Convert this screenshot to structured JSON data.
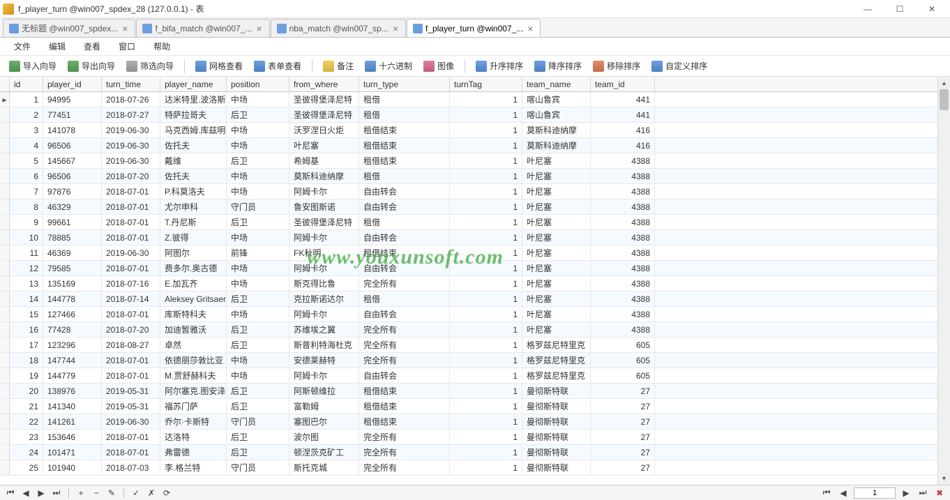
{
  "window": {
    "title": "f_player_turn @win007_spdex_28 (127.0.0.1) - 表"
  },
  "tabs": [
    {
      "label": "无标题 @win007_spdex...",
      "active": false
    },
    {
      "label": "f_bifa_match @win007_...",
      "active": false
    },
    {
      "label": "nba_match @win007_sp...",
      "active": false
    },
    {
      "label": "f_player_turn @win007_...",
      "active": true
    }
  ],
  "menu": [
    "文件",
    "编辑",
    "查看",
    "窗口",
    "帮助"
  ],
  "toolbar": {
    "import": "导入向导",
    "export": "导出向导",
    "filter": "筛选向导",
    "grid": "网格查看",
    "form": "表单查看",
    "note": "备注",
    "hex": "十六进制",
    "image": "图像",
    "asc": "升序排序",
    "desc": "降序排序",
    "remove": "移除排序",
    "custom": "自定义排序"
  },
  "columns": [
    "id",
    "player_id",
    "turn_time",
    "player_name",
    "position",
    "from_where",
    "turn_type",
    "turnTag",
    "team_name",
    "team_id"
  ],
  "rows": [
    {
      "id": 1,
      "player_id": "94995",
      "turn_time": "2018-07-26",
      "player_name": "达米特里.波洛斯",
      "position": "中场",
      "from_where": "圣彼得堡泽尼特",
      "turn_type": "租借",
      "turnTag": 1,
      "team_name": "喀山鲁宾",
      "team_id": 441
    },
    {
      "id": 2,
      "player_id": "77451",
      "turn_time": "2018-07-27",
      "player_name": "特萨拉哥夫",
      "position": "后卫",
      "from_where": "圣彼得堡泽尼特",
      "turn_type": "租借",
      "turnTag": 1,
      "team_name": "喀山鲁宾",
      "team_id": 441
    },
    {
      "id": 3,
      "player_id": "141078",
      "turn_time": "2019-06-30",
      "player_name": "马克西姆.库兹明",
      "position": "中场",
      "from_where": "沃罗涅日火炬",
      "turn_type": "租借结束",
      "turnTag": 1,
      "team_name": "莫斯科迪纳摩",
      "team_id": 416
    },
    {
      "id": 4,
      "player_id": "96506",
      "turn_time": "2019-06-30",
      "player_name": "佐托夫",
      "position": "中场",
      "from_where": "叶尼塞",
      "turn_type": "租借结束",
      "turnTag": 1,
      "team_name": "莫斯科迪纳摩",
      "team_id": 416
    },
    {
      "id": 5,
      "player_id": "145667",
      "turn_time": "2019-06-30",
      "player_name": "戴维",
      "position": "后卫",
      "from_where": "希姆基",
      "turn_type": "租借结束",
      "turnTag": 1,
      "team_name": "叶尼塞",
      "team_id": 4388
    },
    {
      "id": 6,
      "player_id": "96506",
      "turn_time": "2018-07-20",
      "player_name": "佐托夫",
      "position": "中场",
      "from_where": "莫斯科迪纳摩",
      "turn_type": "租借",
      "turnTag": 1,
      "team_name": "叶尼塞",
      "team_id": 4388
    },
    {
      "id": 7,
      "player_id": "97876",
      "turn_time": "2018-07-01",
      "player_name": "P.科莫洛夫",
      "position": "中场",
      "from_where": "阿姆卡尔",
      "turn_type": "自由转会",
      "turnTag": 1,
      "team_name": "叶尼塞",
      "team_id": 4388
    },
    {
      "id": 8,
      "player_id": "46329",
      "turn_time": "2018-07-01",
      "player_name": "尤尔申科",
      "position": "守门员",
      "from_where": "鲁安图斯诺",
      "turn_type": "自由转会",
      "turnTag": 1,
      "team_name": "叶尼塞",
      "team_id": 4388
    },
    {
      "id": 9,
      "player_id": "99661",
      "turn_time": "2018-07-01",
      "player_name": "T.丹尼斯",
      "position": "后卫",
      "from_where": "圣彼得堡泽尼特",
      "turn_type": "租借",
      "turnTag": 1,
      "team_name": "叶尼塞",
      "team_id": 4388
    },
    {
      "id": 10,
      "player_id": "78885",
      "turn_time": "2018-07-01",
      "player_name": "Z.彼得",
      "position": "中场",
      "from_where": "阿姆卡尔",
      "turn_type": "自由转会",
      "turnTag": 1,
      "team_name": "叶尼塞",
      "team_id": 4388
    },
    {
      "id": 11,
      "player_id": "46369",
      "turn_time": "2019-06-30",
      "player_name": "阿图尔",
      "position": "前锋",
      "from_where": "FK秋明",
      "turn_type": "租借结束",
      "turnTag": 1,
      "team_name": "叶尼塞",
      "team_id": 4388
    },
    {
      "id": 12,
      "player_id": "79585",
      "turn_time": "2018-07-01",
      "player_name": "费多尔.奥古德",
      "position": "中场",
      "from_where": "阿姆卡尔",
      "turn_type": "自由转会",
      "turnTag": 1,
      "team_name": "叶尼塞",
      "team_id": 4388
    },
    {
      "id": 13,
      "player_id": "135169",
      "turn_time": "2018-07-16",
      "player_name": "E.加瓦齐",
      "position": "中场",
      "from_where": "斯克得比鲁",
      "turn_type": "完全所有",
      "turnTag": 1,
      "team_name": "叶尼塞",
      "team_id": 4388
    },
    {
      "id": 14,
      "player_id": "144778",
      "turn_time": "2018-07-14",
      "player_name": "Aleksey Gritsaenl",
      "position": "后卫",
      "from_where": "克拉斯诺达尔",
      "turn_type": "租借",
      "turnTag": 1,
      "team_name": "叶尼塞",
      "team_id": 4388
    },
    {
      "id": 15,
      "player_id": "127466",
      "turn_time": "2018-07-01",
      "player_name": "库斯特科夫",
      "position": "中场",
      "from_where": "阿姆卡尔",
      "turn_type": "自由转会",
      "turnTag": 1,
      "team_name": "叶尼塞",
      "team_id": 4388
    },
    {
      "id": 16,
      "player_id": "77428",
      "turn_time": "2018-07-20",
      "player_name": "加迪暂雅沃",
      "position": "后卫",
      "from_where": "苏维埃之翼",
      "turn_type": "完全所有",
      "turnTag": 1,
      "team_name": "叶尼塞",
      "team_id": 4388
    },
    {
      "id": 17,
      "player_id": "123296",
      "turn_time": "2018-08-27",
      "player_name": "卓然",
      "position": "后卫",
      "from_where": "斯普利特海杜克",
      "turn_type": "完全所有",
      "turnTag": 1,
      "team_name": "格罗兹尼特里克",
      "team_id": 605
    },
    {
      "id": 18,
      "player_id": "147744",
      "turn_time": "2018-07-01",
      "player_name": "依德丽莎敦比亚",
      "position": "中场",
      "from_where": "安德莱赫特",
      "turn_type": "完全所有",
      "turnTag": 1,
      "team_name": "格罗兹尼特里克",
      "team_id": 605
    },
    {
      "id": 19,
      "player_id": "144779",
      "turn_time": "2018-07-01",
      "player_name": "M.贾舒赫科夫",
      "position": "中场",
      "from_where": "阿姆卡尔",
      "turn_type": "自由转会",
      "turnTag": 1,
      "team_name": "格罗兹尼特里克",
      "team_id": 605
    },
    {
      "id": 20,
      "player_id": "138976",
      "turn_time": "2019-05-31",
      "player_name": "阿尔塞克.图安泽比",
      "position": "后卫",
      "from_where": "阿斯顿维拉",
      "turn_type": "租借结束",
      "turnTag": 1,
      "team_name": "曼彻斯特联",
      "team_id": 27
    },
    {
      "id": 21,
      "player_id": "141340",
      "turn_time": "2019-05-31",
      "player_name": "福苏门萨",
      "position": "后卫",
      "from_where": "富勒姆",
      "turn_type": "租借结束",
      "turnTag": 1,
      "team_name": "曼彻斯特联",
      "team_id": 27
    },
    {
      "id": 22,
      "player_id": "141261",
      "turn_time": "2019-06-30",
      "player_name": "乔尔&#183;卡斯特",
      "position": "守门员",
      "from_where": "塞图巴尔",
      "turn_type": "租借结束",
      "turnTag": 1,
      "team_name": "曼彻斯特联",
      "team_id": 27
    },
    {
      "id": 23,
      "player_id": "153646",
      "turn_time": "2018-07-01",
      "player_name": "达洛特",
      "position": "后卫",
      "from_where": "波尔图",
      "turn_type": "完全所有",
      "turnTag": 1,
      "team_name": "曼彻斯特联",
      "team_id": 27
    },
    {
      "id": 24,
      "player_id": "101471",
      "turn_time": "2018-07-01",
      "player_name": "弗雷德",
      "position": "后卫",
      "from_where": "顿涅茨克矿工",
      "turn_type": "完全所有",
      "turnTag": 1,
      "team_name": "曼彻斯特联",
      "team_id": 27
    },
    {
      "id": 25,
      "player_id": "101940",
      "turn_time": "2018-07-03",
      "player_name": "李.格兰特",
      "position": "守门员",
      "from_where": "斯托克城",
      "turn_type": "完全所有",
      "turnTag": 1,
      "team_name": "曼彻斯特联",
      "team_id": 27
    }
  ],
  "status": {
    "page": "1"
  },
  "watermark": "www.youxunsoft.com"
}
